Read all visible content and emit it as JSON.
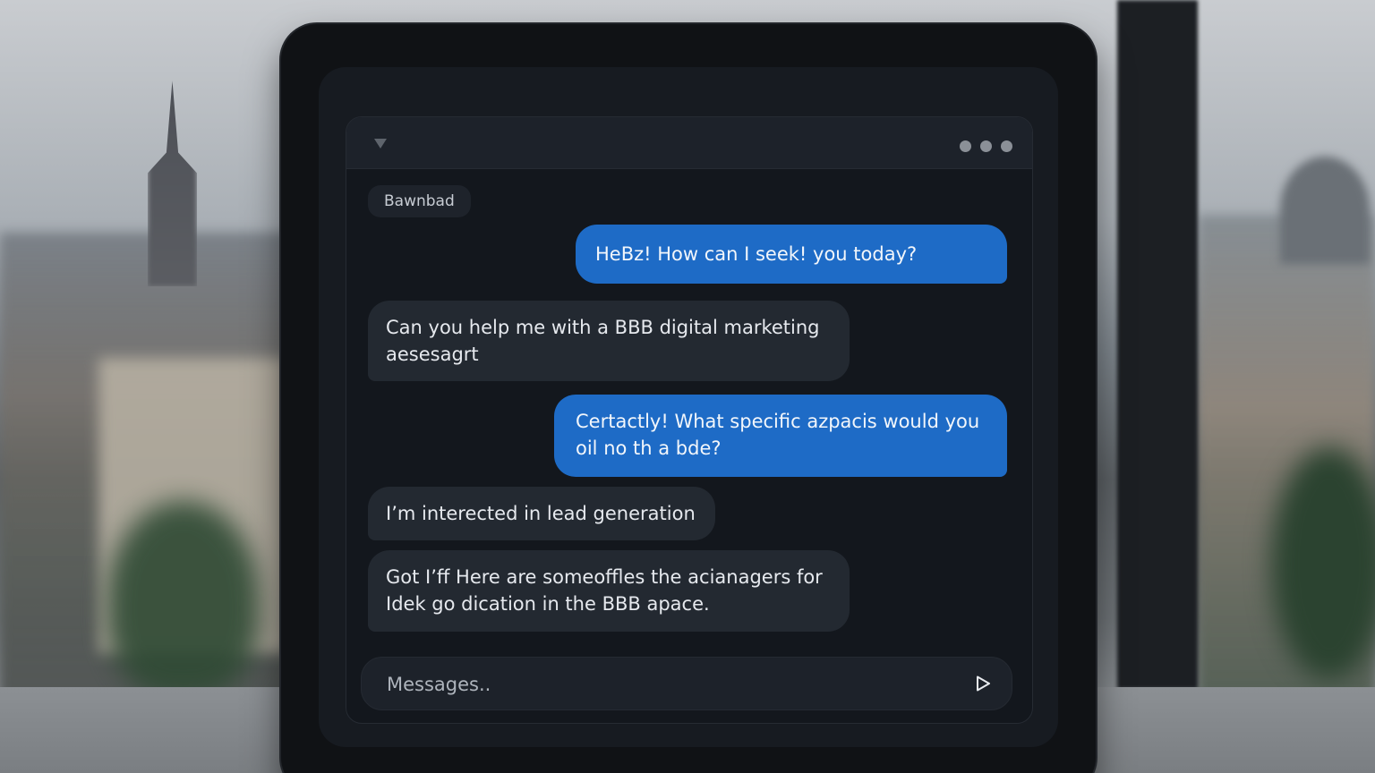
{
  "chat": {
    "tag_label": "Bawnbad",
    "messages": [
      {
        "role": "assistant",
        "text": "HeBz! How can I seek! you today?"
      },
      {
        "role": "user",
        "text": "Can you help me with a BBB digital marketing aesesagrt"
      },
      {
        "role": "assistant",
        "text": "Certactly! What specific azpacis would you oil no th a bde?"
      },
      {
        "role": "user",
        "text": "I’m interected in lead generation"
      },
      {
        "role": "user",
        "text": "Got I’ff Here are someoffles the acianagers for Idek go dication in the BBB apace."
      }
    ]
  },
  "composer": {
    "placeholder": "Messages.."
  },
  "colors": {
    "outgoing_bubble": "#1e6bc6",
    "incoming_bubble": "#232931",
    "window_bg": "#13171d"
  },
  "icons": {
    "title_icon": "heart-icon",
    "menu_icon": "more-dots-icon",
    "send_icon": "send-icon"
  }
}
